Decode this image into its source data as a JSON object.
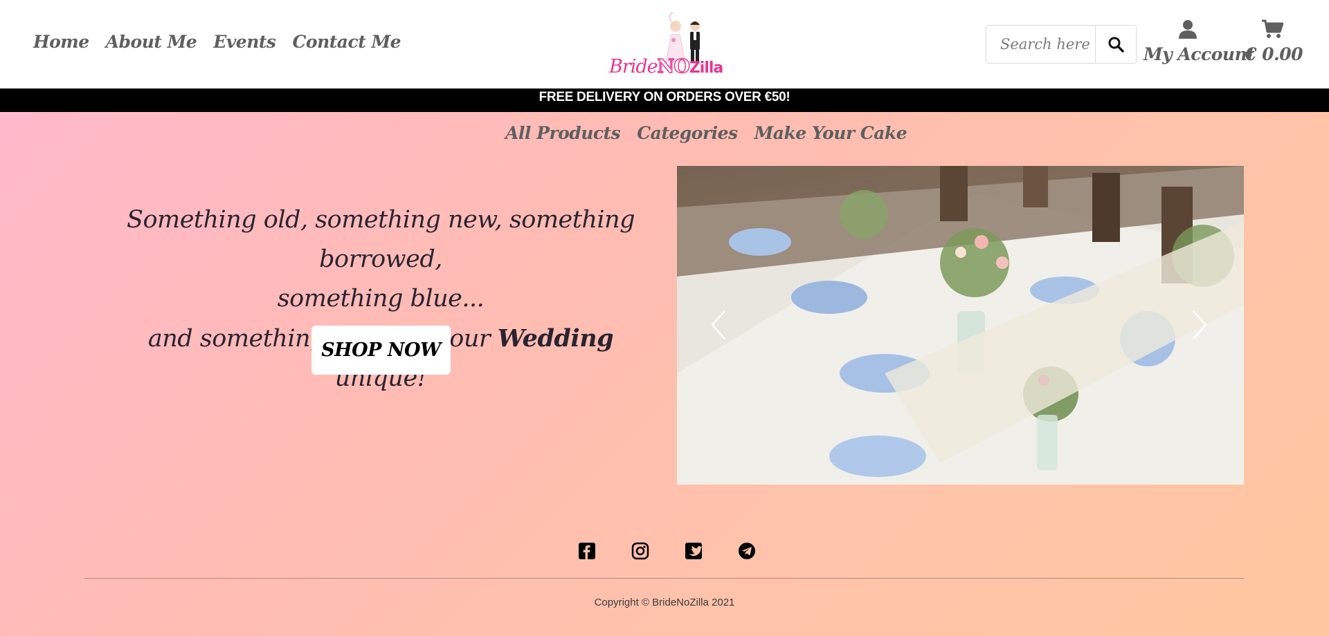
{
  "header": {
    "nav": [
      {
        "label": "Home"
      },
      {
        "label": "About Me"
      },
      {
        "label": "Events"
      },
      {
        "label": "Contact Me"
      }
    ],
    "logo": {
      "part1": "Bride",
      "part2": "NO",
      "part3": "Zilla"
    },
    "search": {
      "placeholder": "Search here"
    },
    "account_label": "My Account",
    "cart_total": "€ 0.00"
  },
  "banner": {
    "text": "FREE DELIVERY ON ORDERS OVER €50!"
  },
  "sub_nav": [
    {
      "label": "All Products"
    },
    {
      "label": "Categories"
    },
    {
      "label": "Make Your Cake"
    }
  ],
  "hero": {
    "line1": "Something old, something new, something borrowed,",
    "line2": "something blue...",
    "line3_start": "and something to make your",
    "line3_em": "Wedding",
    "line3_end": "unique!",
    "cta_label": "SHOP NOW"
  },
  "carousel": {
    "prev_icon": "chevron-left-icon",
    "next_icon": "chevron-right-icon"
  },
  "footer": {
    "social": [
      "facebook-icon",
      "instagram-icon",
      "twitter-icon",
      "telegram-icon"
    ],
    "copyright": "Copyright © BrideNoZilla 2021"
  },
  "colors": {
    "accent_pink": "#e8358f",
    "nav_text": "#5f5f5f",
    "banner_bg": "#000000",
    "hero_text": "#2b2430"
  }
}
